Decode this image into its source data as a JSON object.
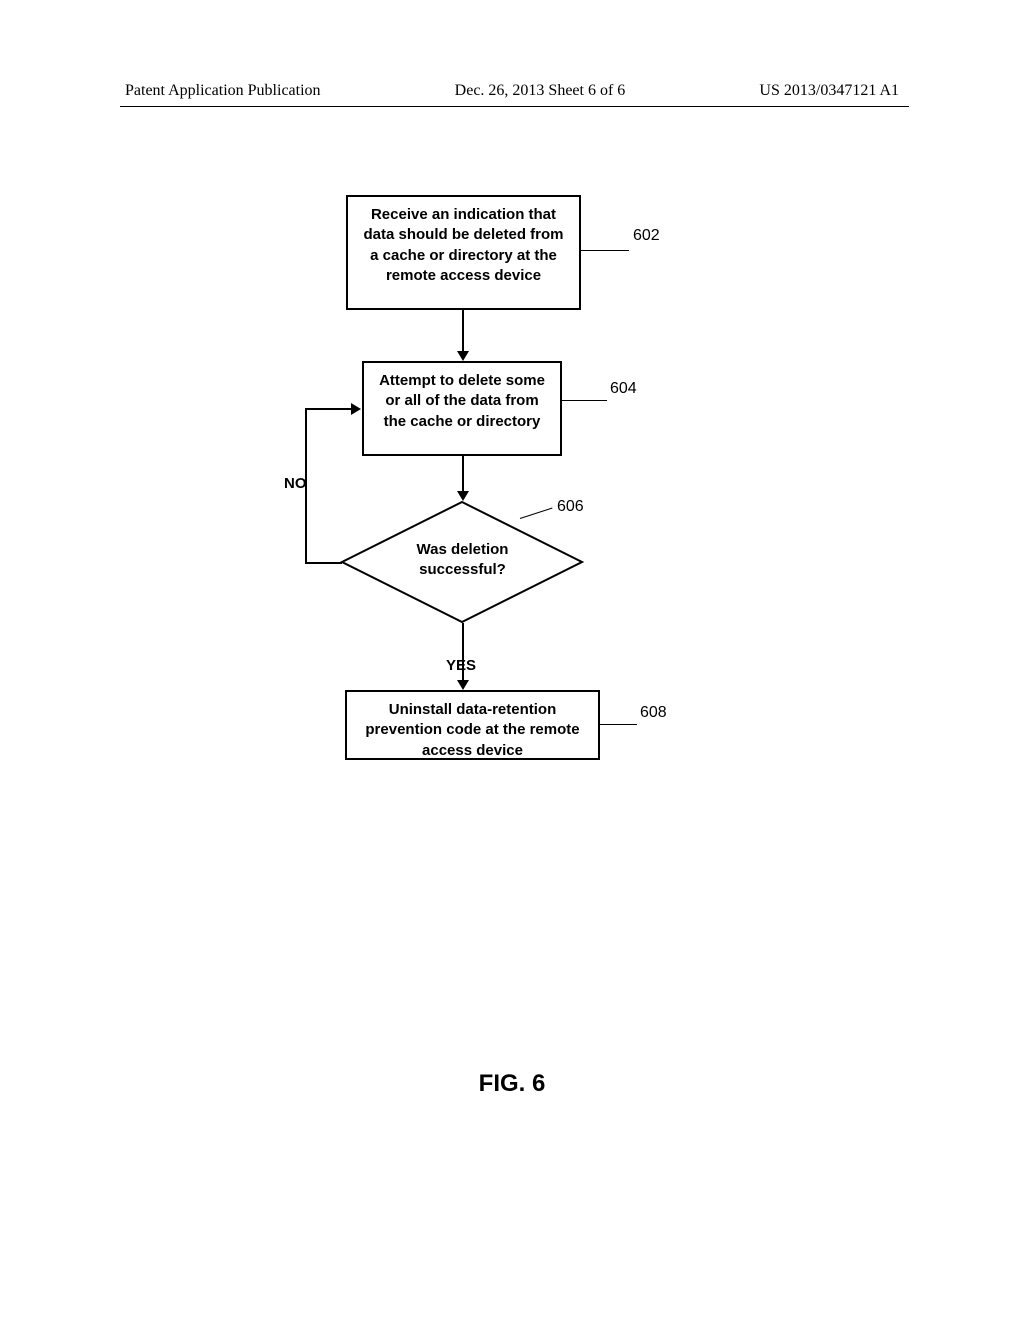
{
  "header": {
    "left": "Patent Application Publication",
    "center": "Dec. 26, 2013  Sheet 6 of 6",
    "right": "US 2013/0347121 A1"
  },
  "chart_data": {
    "type": "flowchart",
    "title": "FIG. 6",
    "nodes": [
      {
        "id": "602",
        "type": "process",
        "text": "Receive an indication that data should be deleted from a cache or directory at the remote access device"
      },
      {
        "id": "604",
        "type": "process",
        "text": "Attempt to delete some or all of the data from the cache or directory"
      },
      {
        "id": "606",
        "type": "decision",
        "text": "Was deletion successful?"
      },
      {
        "id": "608",
        "type": "process",
        "text": "Uninstall data-retention prevention code at the remote access device"
      }
    ],
    "edges": [
      {
        "from": "602",
        "to": "604"
      },
      {
        "from": "604",
        "to": "606"
      },
      {
        "from": "606",
        "to": "604",
        "label": "NO"
      },
      {
        "from": "606",
        "to": "608",
        "label": "YES"
      }
    ]
  },
  "labels": {
    "no": "NO",
    "yes": "YES",
    "ref602": "602",
    "ref604": "604",
    "ref606": "606",
    "ref608": "608"
  }
}
